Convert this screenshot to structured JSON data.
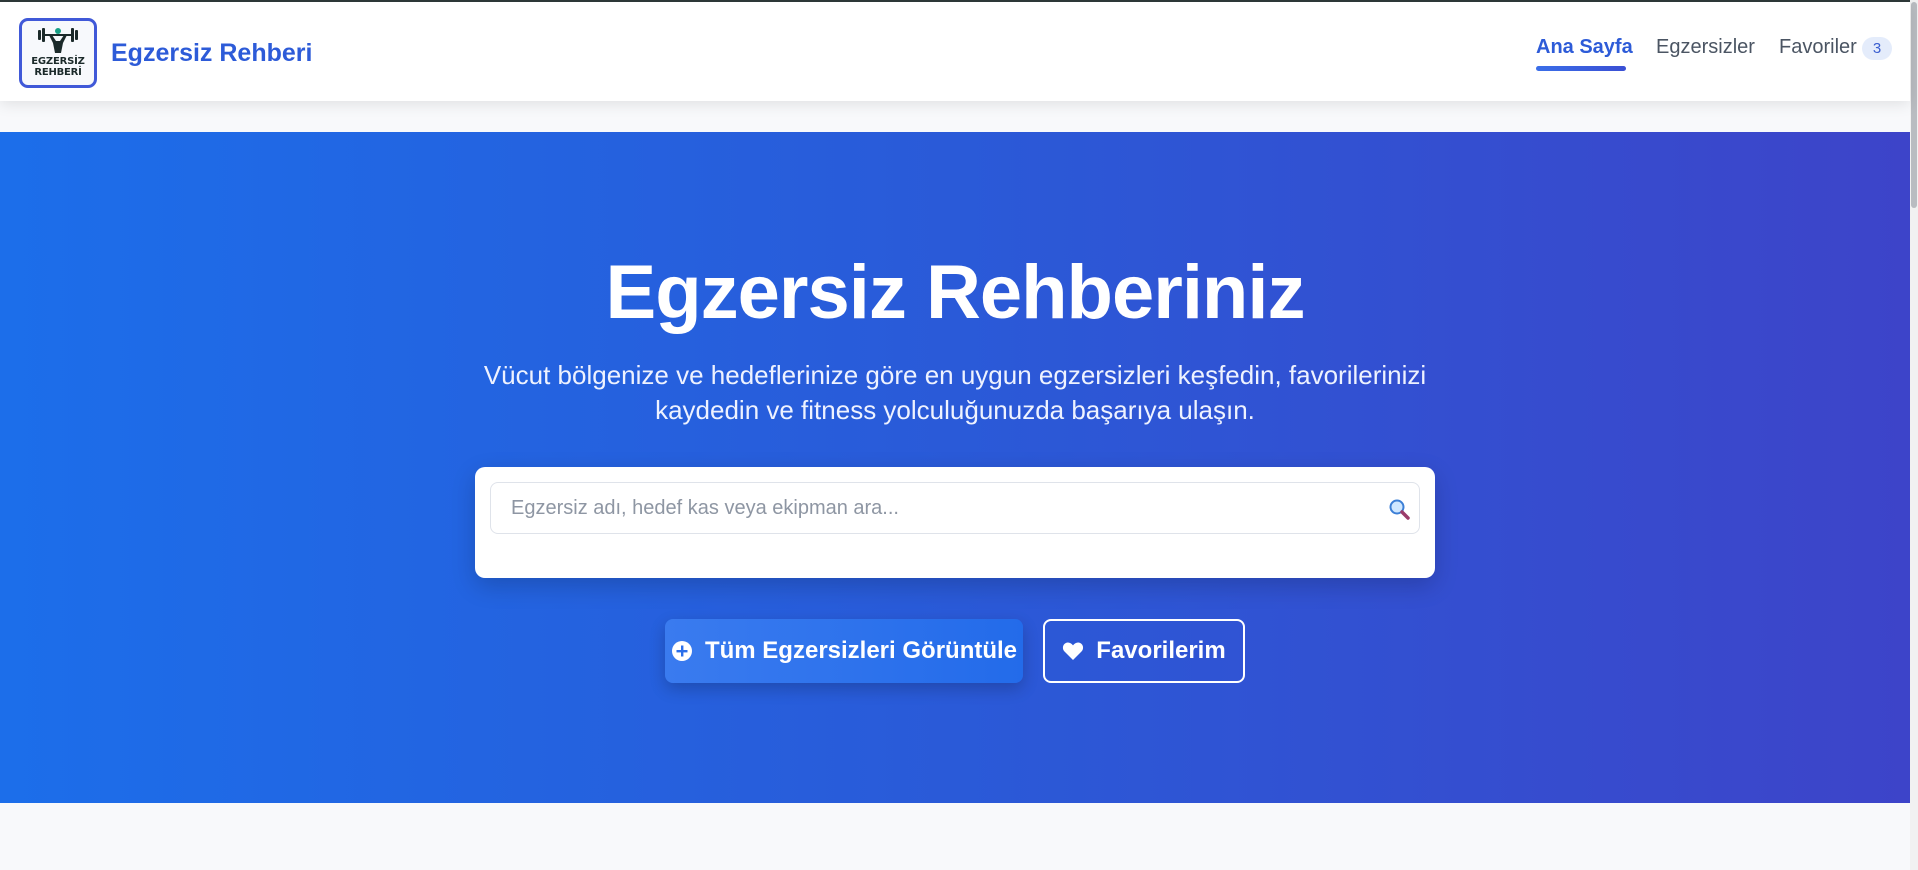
{
  "header": {
    "logo_text": "EGZERSİZ\nREHBERİ",
    "brand": "Egzersiz Rehberi"
  },
  "nav": {
    "items": [
      {
        "label": "Ana Sayfa",
        "active": true
      },
      {
        "label": "Egzersizler",
        "active": false
      },
      {
        "label": "Favoriler",
        "active": false
      }
    ],
    "favorites_count": "3"
  },
  "hero": {
    "title": "Egzersiz Rehberiniz",
    "subtitle": "Vücut bölgenize ve hedeflerinize göre en uygun egzersizleri keşfedin, favorilerinizi kaydedin ve fitness yolculuğunuzda başarıya ulaşın.",
    "search": {
      "placeholder": "Egzersiz adı, hedef kas veya ekipman ara...",
      "value": ""
    },
    "primary_button": "Tüm Egzersizleri Görüntüle",
    "secondary_button": "Favorilerim"
  },
  "colors": {
    "brand": "#2d5bd8",
    "hero_start": "#1c6eea",
    "hero_end": "#3d44c9"
  },
  "icons": {
    "logo": "weightlifter-icon",
    "search": "magnifier-icon",
    "primary": "plus-circle-icon",
    "secondary": "heart-icon"
  }
}
